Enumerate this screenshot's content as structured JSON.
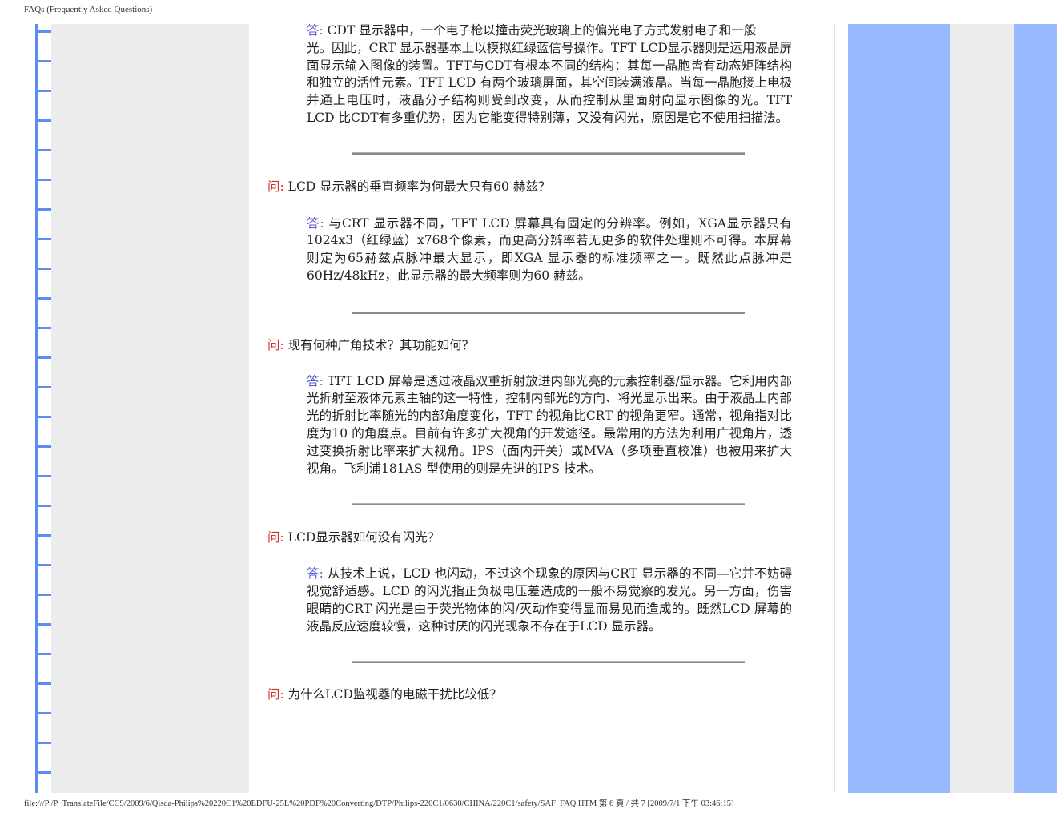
{
  "header_title": "FAQs (Frequently Asked Questions)",
  "footer_path": "file:///P|/P_TranslateFile/CC9/2009/6/Qisda-Philips%20220C1%20EDFU-25L%20PDF%20Converting/DTP/Philips-220C1/0630/CHINA/220C1/safety/SAF_FAQ.HTM 第 6 頁 / 共 7 [2009/7/1 下午 03:46:15]",
  "labels": {
    "answer": "答:",
    "question": "问:"
  },
  "faq": [
    {
      "answer_head": "CDT 显示器中，一个电子枪以撞击荧光玻璃上的偏光电子方式发射电子和一般",
      "answer": "光。因此，CRT 显示器基本上以模拟红绿蓝信号操作。TFT LCD显示器则是运用液晶屏面显示输入图像的装置。TFT与CDT有根本不同的结构：其每一晶胞皆有动态矩阵结构和独立的活性元素。TFT LCD 有两个玻璃屏面，其空间装满液晶。当每一晶胞接上电极并通上电压时，液晶分子结构则受到改变，从而控制从里面射向显示图像的光。TFT LCD 比CDT有多重优势，因为它能变得特别薄，又没有闪光，原因是它不使用扫描法。"
    },
    {
      "question": "LCD 显示器的垂直频率为何最大只有60 赫兹？",
      "answer": "与CRT 显示器不同，TFT LCD 屏幕具有固定的分辨率。例如，XGA显示器只有1024x3（红绿蓝）x768个像素，而更高分辨率若无更多的软件处理则不可得。本屏幕则定为65赫兹点脉冲最大显示，即XGA 显示器的标准频率之一。既然此点脉冲是60Hz/48kHz，此显示器的最大频率则为60 赫兹。"
    },
    {
      "question": "现有何种广角技术？其功能如何？",
      "answer": "TFT LCD 屏幕是透过液晶双重折射放进内部光亮的元素控制器/显示器。它利用内部光折射至液体元素主轴的这一特性，控制内部光的方向、将光显示出来。由于液晶上内部光的折射比率随光的内部角度变化，TFT 的视角比CRT 的视角更窄。通常，视角指对比度为10 的角度点。目前有许多扩大视角的开发途径。最常用的方法为利用广视角片，透过变换折射比率来扩大视角。IPS（面内开关）或MVA（多项垂直校准）也被用来扩大视角。飞利浦181AS 型使用的则是先进的IPS 技术。"
    },
    {
      "question": "LCD显示器如何没有闪光？",
      "answer": "从技术上说，LCD 也闪动，不过这个现象的原因与CRT 显示器的不同—它并不妨碍视觉舒适感。LCD 的闪光指正负极电压差造成的一般不易觉察的发光。另一方面，伤害眼睛的CRT 闪光是由于荧光物体的闪/灭动作变得显而易见而造成的。既然LCD 屏幕的液晶反应速度较慢，这种讨厌的闪光现象不存在于LCD 显示器。"
    },
    {
      "question": "为什么LCD监视器的电磁干扰比较低？"
    }
  ]
}
